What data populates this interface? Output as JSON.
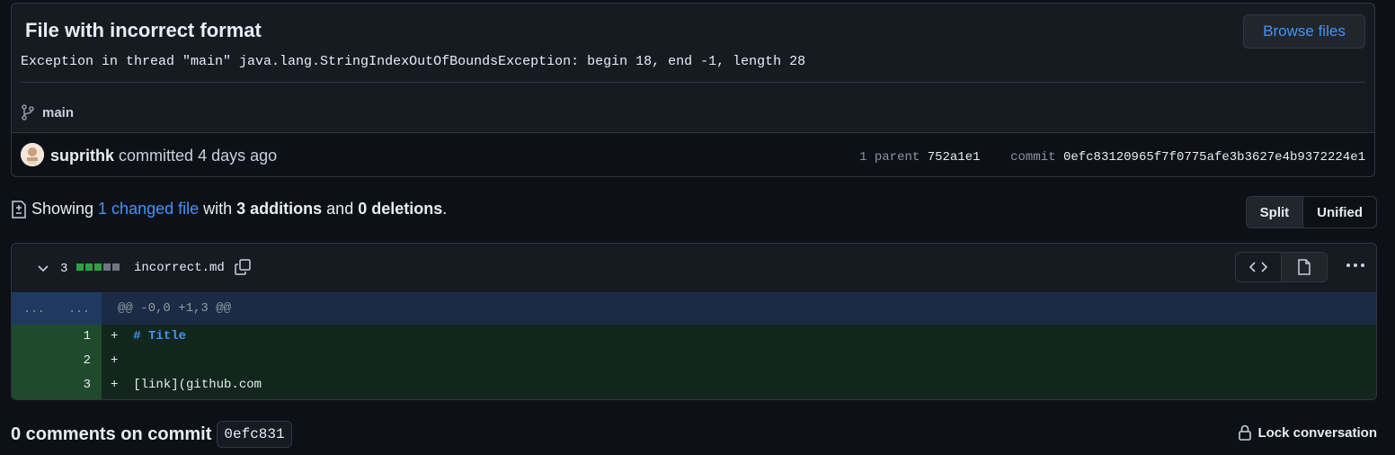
{
  "commit": {
    "title": "File with incorrect format",
    "description": "Exception in thread \"main\" java.lang.StringIndexOutOfBoundsException: begin 18, end -1, length 28",
    "browse_label": "Browse files",
    "branch": "main",
    "author": "suprithk",
    "action": "committed",
    "time": "4 days ago",
    "parent_count_label": "1 parent",
    "parent_sha": "752a1e1",
    "commit_label": "commit",
    "sha": "0efc83120965f7f0775afe3b3627e4b9372224e1"
  },
  "summary": {
    "prefix": "Showing",
    "changed_files": "1 changed file",
    "with": "with",
    "additions": "3 additions",
    "and": "and",
    "deletions": "0 deletions",
    "suffix": "."
  },
  "view_toggle": {
    "split": "Split",
    "unified": "Unified",
    "selected": "Split"
  },
  "diff": {
    "change_count": "3",
    "stat_blocks": [
      "#2ea043",
      "#2ea043",
      "#2ea043",
      "#6e7681",
      "#6e7681"
    ],
    "filename": "incorrect.md",
    "hunk": {
      "left_ln": "...",
      "right_ln": "...",
      "header": "@@ -0,0 +1,3 @@"
    },
    "lines": [
      {
        "num": "1",
        "sign": "+",
        "code_token": "# Title",
        "code_rest": ""
      },
      {
        "num": "2",
        "sign": "+",
        "code_token": "",
        "code_rest": ""
      },
      {
        "num": "3",
        "sign": "+",
        "code_token": "",
        "code_rest": "[link](github.com"
      }
    ]
  },
  "comments": {
    "label": "0 comments on commit",
    "short_sha": "0efc831",
    "lock_label": "Lock conversation"
  },
  "icons": [
    "git-branch-icon",
    "file-diff-icon",
    "chevron-down-icon",
    "copy-icon",
    "code-icon",
    "file-icon",
    "kebab-horizontal-icon",
    "lock-icon"
  ],
  "colors": {
    "accent": "#4493f8",
    "addition": "#2ea043",
    "background": "#0d1117"
  }
}
